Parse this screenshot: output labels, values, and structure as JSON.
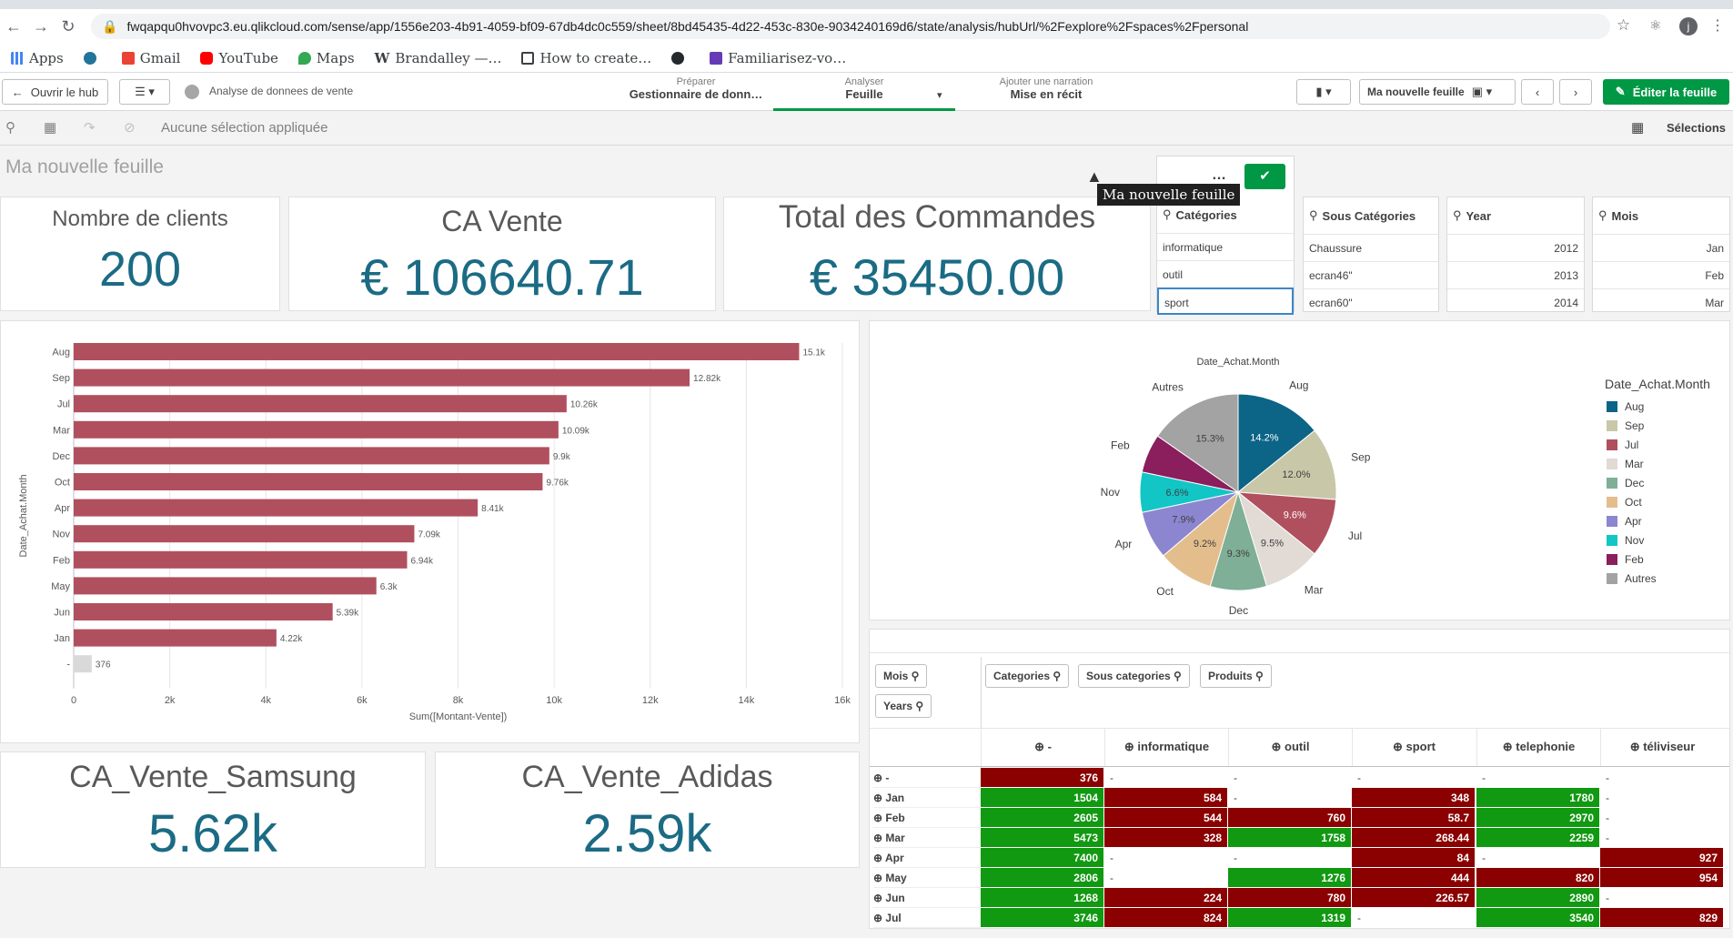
{
  "browser": {
    "url": "fwqapqu0hvovpc3.eu.qlikcloud.com/sense/app/1556e203-4b91-4059-bf09-67db4dc0c559/sheet/8bd45435-4d22-453c-830e-9034240169d6/state/analysis/hubUrl/%2Fexplore%2Fspaces%2Fpersonal",
    "bookmarks": [
      "Apps",
      "",
      "Gmail",
      "YouTube",
      "Maps",
      "Brandalley —…",
      "How to create…",
      "",
      "Familiarisez-vo…"
    ]
  },
  "toolbar": {
    "hub": "Ouvrir le hub",
    "app_name": "Analyse de donnees de vente",
    "prep_label": "Préparer",
    "prep_value": "Gestionnaire de donn…",
    "analyse_label": "Analyser",
    "analyse_value": "Feuille",
    "narr_label": "Ajouter une narration",
    "narr_value": "Mise en récit",
    "sheet_name": "Ma nouvelle feuille",
    "edit": "Éditer la feuille"
  },
  "selbar": {
    "text": "Aucune sélection appliquée",
    "selections": "Sélections"
  },
  "sheet_title": "Ma nouvelle feuille",
  "tooltip": "Ma nouvelle feuille",
  "kpis": {
    "clients_t": "Nombre de clients",
    "clients_v": "200",
    "ca_t": "CA Vente",
    "ca_v": "€ 106640.71",
    "cmd_t": "Total des Commandes",
    "cmd_v": "€ 35450.00",
    "samsung_t": "CA_Vente_Samsung",
    "samsung_v": "5.62k",
    "adidas_t": "CA_Vente_Adidas",
    "adidas_v": "2.59k"
  },
  "filters": {
    "cat": {
      "title": "Catégories",
      "items": [
        "informatique",
        "outil",
        "sport"
      ]
    },
    "sous": {
      "title": "Sous Catégories",
      "items": [
        "Chaussure",
        "ecran46\"",
        "ecran60\""
      ]
    },
    "year": {
      "title": "Year",
      "items": [
        "2012",
        "2013",
        "2014"
      ]
    },
    "mois": {
      "title": "Mois",
      "items": [
        "Jan",
        "Feb",
        "Mar"
      ]
    }
  },
  "chart_data": [
    {
      "type": "bar",
      "orientation": "horizontal",
      "xlabel": "Sum([Montant-Vente])",
      "ylabel": "Date_Achat.Month",
      "categories": [
        "Aug",
        "Sep",
        "Jul",
        "Mar",
        "Dec",
        "Oct",
        "Apr",
        "Nov",
        "Feb",
        "May",
        "Jun",
        "Jan",
        "-"
      ],
      "values": [
        15100,
        12820,
        10260,
        10090,
        9900,
        9760,
        8410,
        7090,
        6940,
        6300,
        5390,
        4220,
        376
      ],
      "labels": [
        "15.1k",
        "12.82k",
        "10.26k",
        "10.09k",
        "9.9k",
        "9.76k",
        "8.41k",
        "7.09k",
        "6.94k",
        "6.3k",
        "5.39k",
        "4.22k",
        "376"
      ],
      "xticks": [
        "0",
        "2k",
        "4k",
        "6k",
        "8k",
        "10k",
        "12k",
        "14k",
        "16k"
      ],
      "xlim": [
        0,
        16000
      ],
      "color": "#b0505e",
      "null_color": "#d9d9d9",
      "grid": true
    },
    {
      "type": "pie",
      "title": "Date_Achat.Month",
      "legend_title": "Date_Achat.Month",
      "legend_position": "right",
      "slices": [
        {
          "name": "Aug",
          "value": 14.2,
          "label": "14.2%",
          "color": "#0c6487"
        },
        {
          "name": "Sep",
          "value": 12.0,
          "label": "12.0%",
          "color": "#c8c7a8"
        },
        {
          "name": "Jul",
          "value": 9.6,
          "label": "9.6%",
          "color": "#b0505e"
        },
        {
          "name": "Mar",
          "value": 9.5,
          "label": "9.5%",
          "color": "#e1dad5"
        },
        {
          "name": "Dec",
          "value": 9.3,
          "label": "9.3%",
          "color": "#7faf96"
        },
        {
          "name": "Oct",
          "value": 9.2,
          "label": "9.2%",
          "color": "#e3be8c"
        },
        {
          "name": "Apr",
          "value": 7.9,
          "label": "7.9%",
          "color": "#8c86d0"
        },
        {
          "name": "Nov",
          "value": 6.6,
          "label": "6.6%",
          "color": "#12c6c6"
        },
        {
          "name": "Feb",
          "value": 6.4,
          "label": "",
          "color": "#8b1e5c"
        },
        {
          "name": "Autres",
          "value": 15.3,
          "label": "15.3%",
          "color": "#a3a3a3"
        }
      ]
    }
  ],
  "pivot": {
    "row_chips": [
      "Mois",
      "Years"
    ],
    "col_chips": [
      "Categories",
      "Sous categories",
      "Produits"
    ],
    "columns": [
      "-",
      "informatique",
      "outil",
      "sport",
      "telephonie",
      "téliviseur"
    ],
    "rows": [
      {
        "m": "-",
        "v": [
          "376",
          "-",
          "-",
          "-",
          "-",
          "-"
        ],
        "c": [
          "rd",
          "w",
          "w",
          "w",
          "w",
          "w"
        ]
      },
      {
        "m": "Jan",
        "v": [
          "1504",
          "584",
          "-",
          "348",
          "1780",
          "-"
        ],
        "c": [
          "g",
          "rd",
          "w",
          "rd",
          "g",
          "w"
        ]
      },
      {
        "m": "Feb",
        "v": [
          "2605",
          "544",
          "760",
          "58.7",
          "2970",
          "-"
        ],
        "c": [
          "g",
          "rd",
          "rd",
          "rd",
          "g",
          "w"
        ]
      },
      {
        "m": "Mar",
        "v": [
          "5473",
          "328",
          "1758",
          "268.44",
          "2259",
          "-"
        ],
        "c": [
          "g",
          "rd",
          "g",
          "rd",
          "g",
          "w"
        ]
      },
      {
        "m": "Apr",
        "v": [
          "7400",
          "-",
          "-",
          "84",
          "-",
          "927"
        ],
        "c": [
          "g",
          "w",
          "w",
          "rd",
          "w",
          "rd"
        ]
      },
      {
        "m": "May",
        "v": [
          "2806",
          "-",
          "1276",
          "444",
          "820",
          "954"
        ],
        "c": [
          "g",
          "w",
          "g",
          "rd",
          "rd",
          "rd"
        ]
      },
      {
        "m": "Jun",
        "v": [
          "1268",
          "224",
          "780",
          "226.57",
          "2890",
          "-"
        ],
        "c": [
          "g",
          "rd",
          "rd",
          "rd",
          "g",
          "w"
        ]
      },
      {
        "m": "Jul",
        "v": [
          "3746",
          "824",
          "1319",
          "-",
          "3540",
          "829"
        ],
        "c": [
          "g",
          "rd",
          "g",
          "w",
          "g",
          "rd"
        ]
      }
    ]
  }
}
